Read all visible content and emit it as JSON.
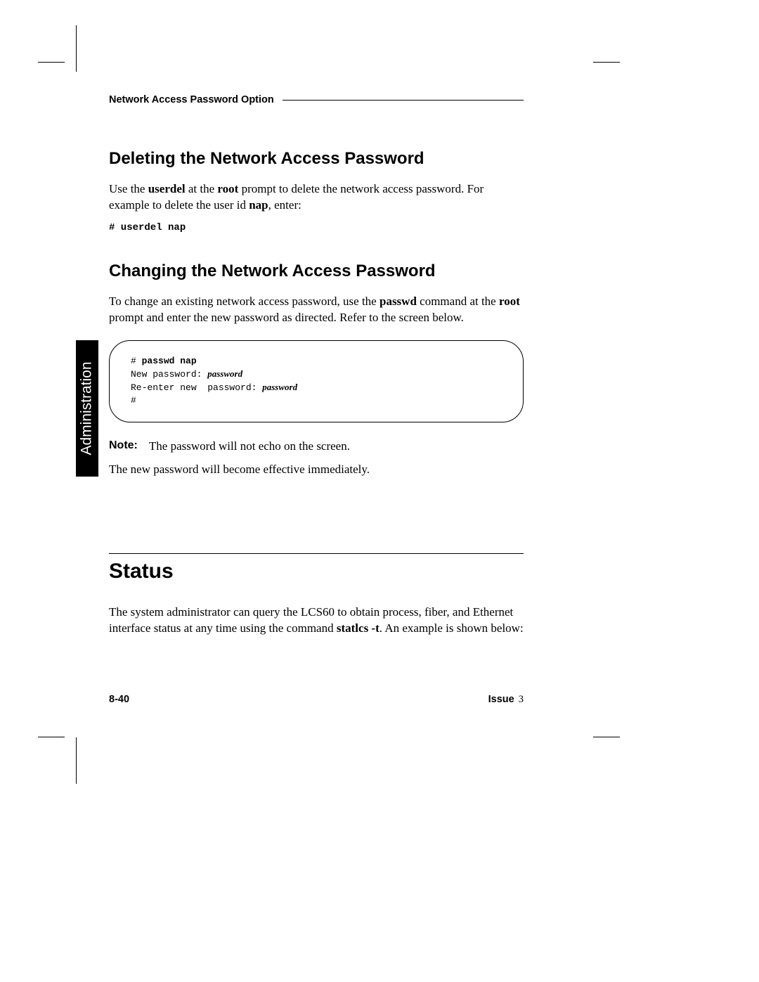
{
  "header": {
    "running_head": "Network Access Password Option"
  },
  "side_tab": "Administration",
  "sections": {
    "delete": {
      "heading": "Deleting the Network Access Password",
      "para_parts": {
        "t1": "Use the ",
        "b1": "userdel",
        "t2": " at the ",
        "b2": "root",
        "t3": " prompt to delete the network access password.  For example to delete the user id ",
        "b3": "nap",
        "t4": ", enter:"
      },
      "command": "# userdel nap"
    },
    "change": {
      "heading": "Changing the Network Access Password",
      "para_parts": {
        "t1": "To change an existing network access password, use the ",
        "b1": "passwd",
        "t2": " command at the ",
        "b2": "root",
        "t3": " prompt and enter the new password as directed.  Refer to the screen below."
      },
      "terminal": {
        "l1_prompt": "# ",
        "l1_cmd": "passwd nap",
        "l2_text": "New password: ",
        "l2_var": "password",
        "l3_text": "Re-enter new  password: ",
        "l3_var": "password",
        "l4": "#"
      },
      "note_label": "Note:",
      "note_text": "The password will not echo on the screen.",
      "after_note": "The new password will become effective immediately."
    },
    "status": {
      "heading": "Status",
      "para_parts": {
        "t1": "The system administrator can query the LCS60 to obtain process, fiber, and Ethernet interface status at any time using the command ",
        "b1": "statlcs -t",
        "t2": ".  An example is shown below:"
      }
    }
  },
  "footer": {
    "page": "8-40",
    "issue_label": "Issue ",
    "issue_num": "3"
  }
}
